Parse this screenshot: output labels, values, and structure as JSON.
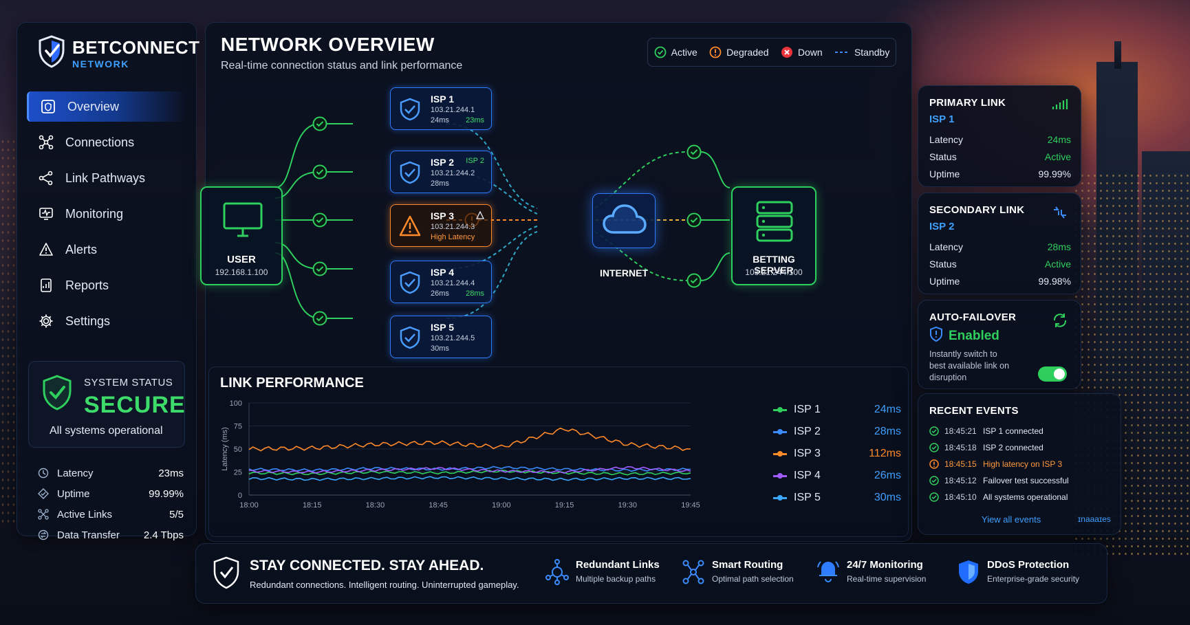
{
  "brand": {
    "name": "BETCONNECT",
    "sub": "NETWORK"
  },
  "sidebar": {
    "items": [
      {
        "label": "Overview",
        "icon": "overview-icon",
        "active": true
      },
      {
        "label": "Connections",
        "icon": "connections-icon"
      },
      {
        "label": "Link Pathways",
        "icon": "pathways-icon"
      },
      {
        "label": "Monitoring",
        "icon": "monitoring-icon"
      },
      {
        "label": "Alerts",
        "icon": "bell-icon"
      },
      {
        "label": "Reports",
        "icon": "reports-icon"
      },
      {
        "label": "Settings",
        "icon": "gear-icon"
      }
    ],
    "system_status": {
      "title": "SYSTEM STATUS",
      "value": "SECURE",
      "subtitle": "All systems operational"
    },
    "stats": [
      {
        "label": "Latency",
        "value": "23ms"
      },
      {
        "label": "Uptime",
        "value": "99.99%"
      },
      {
        "label": "Active Links",
        "value": "5/5"
      },
      {
        "label": "Data Transfer",
        "value": "2.4 Tbps"
      }
    ]
  },
  "main": {
    "title": "NETWORK OVERVIEW",
    "subtitle": "Real-time connection status and link performance",
    "legend": {
      "active": "Active",
      "degraded": "Degraded",
      "down": "Down",
      "standby": "Standby"
    },
    "user": {
      "label": "USER",
      "ip": "192.168.1.100"
    },
    "internet": {
      "label": "INTERNET"
    },
    "server": {
      "label": "BETTING SERVER",
      "ip": "103.21.244.100"
    },
    "isps": [
      {
        "name": "ISP 1",
        "ip": "103.21.244.1",
        "latency": "24ms",
        "tag": "23ms",
        "status": "active"
      },
      {
        "name": "ISP 2",
        "ip": "103.21.244.2",
        "latency": "28ms",
        "tag": "ISP 2",
        "status": "active"
      },
      {
        "name": "ISP 3",
        "ip": "103.21.244.3",
        "latency": "High Latency",
        "status": "degraded"
      },
      {
        "name": "ISP 4",
        "ip": "103.21.244.4",
        "latency": "26ms",
        "tag": "28ms",
        "status": "active"
      },
      {
        "name": "ISP 5",
        "ip": "103.21.244.5",
        "latency": "30ms",
        "status": "active"
      }
    ]
  },
  "perf": {
    "title": "LINK PERFORMANCE",
    "legend": [
      {
        "name": "ISP 1",
        "value": "24ms",
        "color": "#2fcf5e"
      },
      {
        "name": "ISP 2",
        "value": "28ms",
        "color": "#3a8cff"
      },
      {
        "name": "ISP 3",
        "value": "112ms",
        "color": "#ff8a2a"
      },
      {
        "name": "ISP 4",
        "value": "26ms",
        "color": "#a05cff"
      },
      {
        "name": "ISP 5",
        "value": "30ms",
        "color": "#3aa8ff"
      }
    ]
  },
  "chart_data": {
    "type": "line",
    "title": "LINK PERFORMANCE",
    "ylabel": "Latency (ms)",
    "ylim": [
      0,
      100
    ],
    "yticks": [
      "0",
      "25",
      "50",
      "75",
      "100"
    ],
    "x": [
      "18:00",
      "18:15",
      "18:30",
      "18:45",
      "19:00",
      "19:15",
      "19:30",
      "19:45"
    ],
    "grid": true,
    "series": [
      {
        "name": "ISP 1",
        "color": "#2fcf5e",
        "values": [
          24,
          23,
          25,
          24,
          26,
          24,
          23,
          24
        ]
      },
      {
        "name": "ISP 2",
        "color": "#3a8cff",
        "values": [
          28,
          27,
          29,
          28,
          30,
          28,
          27,
          28
        ]
      },
      {
        "name": "ISP 3",
        "color": "#ff8a2a",
        "values": [
          50,
          51,
          55,
          57,
          52,
          72,
          55,
          50
        ]
      },
      {
        "name": "ISP 4",
        "color": "#a05cff",
        "values": [
          26,
          25,
          27,
          29,
          26,
          25,
          30,
          26
        ]
      },
      {
        "name": "ISP 5",
        "color": "#3aa8ff",
        "values": [
          18,
          17,
          18,
          19,
          18,
          17,
          18,
          18
        ]
      }
    ]
  },
  "right": {
    "primary": {
      "title": "PRIMARY LINK",
      "isp": "ISP 1",
      "latency_label": "Latency",
      "latency": "24ms",
      "status_label": "Status",
      "status": "Active",
      "uptime_label": "Uptime",
      "uptime": "99.99%"
    },
    "secondary": {
      "title": "SECONDARY LINK",
      "isp": "ISP 2",
      "latency_label": "Latency",
      "latency": "28ms",
      "status_label": "Status",
      "status": "Active",
      "uptime_label": "Uptime",
      "uptime": "99.98%"
    },
    "failover": {
      "title": "AUTO-FAILOVER",
      "state": "Enabled",
      "desc": "Instantly switch to best available link on disruption",
      "enabled": true
    },
    "events": {
      "title": "RECENT EVENTS",
      "items": [
        {
          "time": "18:45:21",
          "text": "ISP 1 connected",
          "status": "ok"
        },
        {
          "time": "18:45:18",
          "text": "ISP 2 connected",
          "status": "ok"
        },
        {
          "time": "18:45:15",
          "text": "High latency on ISP 3",
          "status": "warn"
        },
        {
          "time": "18:45:12",
          "text": "Failover test successful",
          "status": "ok"
        },
        {
          "time": "18:45:10",
          "text": "All systems operational",
          "status": "ok"
        }
      ],
      "view_all": "Yiew all events",
      "more": "ɪnaaaɪes"
    }
  },
  "banner": {
    "title": "STAY CONNECTED. STAY AHEAD.",
    "subtitle": "Redundant connections. Intelligent routing. Uninterrupted gameplay.",
    "features": [
      {
        "title": "Redundant Links",
        "sub": "Multiple backup paths"
      },
      {
        "title": "Smart Routing",
        "sub": "Optimal path selection"
      },
      {
        "title": "24/7 Monitoring",
        "sub": "Real-time supervision"
      },
      {
        "title": "DDoS Protection",
        "sub": "Enterprise-grade security"
      }
    ]
  },
  "colors": {
    "active": "#2fcf5e",
    "degraded": "#ff8a2a",
    "down": "#e8323c",
    "standby": "#3a8cff",
    "accent": "#3ea0ff"
  }
}
